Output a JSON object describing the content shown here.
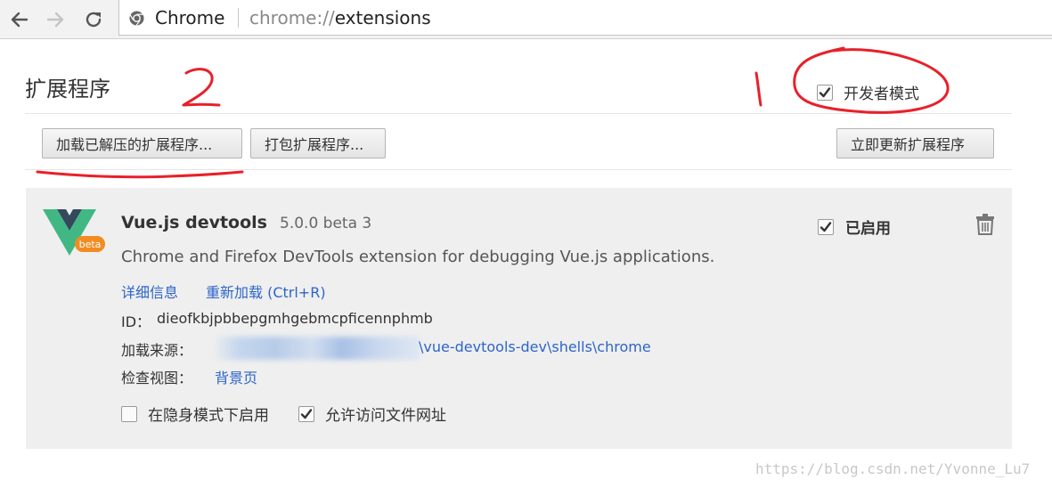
{
  "browser": {
    "site_label": "Chrome",
    "url_scheme": "chrome://",
    "url_path": "extensions"
  },
  "page": {
    "title": "扩展程序",
    "developer_mode_label": "开发者模式",
    "developer_mode_checked": true
  },
  "toolbar_buttons": {
    "load_unpacked": "加载已解压的扩展程序...",
    "pack": "打包扩展程序...",
    "update_now": "立即更新扩展程序"
  },
  "extension": {
    "name": "Vue.js devtools",
    "version": "5.0.0 beta 3",
    "description": "Chrome and Firefox DevTools extension for debugging Vue.js applications.",
    "details_link": "详细信息",
    "reload_link": "重新加载 (Ctrl+R)",
    "id_label": "ID：",
    "id_value": "dieofkbjpbbepgmhgebmcpficennphmb",
    "source_label": "加载来源：",
    "source_path": "\\vue-devtools-dev\\shells\\chrome",
    "inspect_label": "检查视图：",
    "inspect_link": "背景页",
    "enabled_label": "已启用",
    "enabled_checked": true,
    "logo_badge": "beta",
    "incognito_label": "在隐身模式下启用",
    "incognito_checked": false,
    "file_access_label": "允许访问文件网址",
    "file_access_checked": true
  },
  "annotations": {
    "mark_1": "1",
    "mark_2": "2"
  },
  "watermark": "https://blog.csdn.net/Yvonne_Lu7",
  "colors": {
    "link": "#2d65c9",
    "annotation": "#e8202a",
    "vue_green": "#41b883",
    "vue_dark": "#35495e",
    "beta_orange": "#f28c22"
  }
}
